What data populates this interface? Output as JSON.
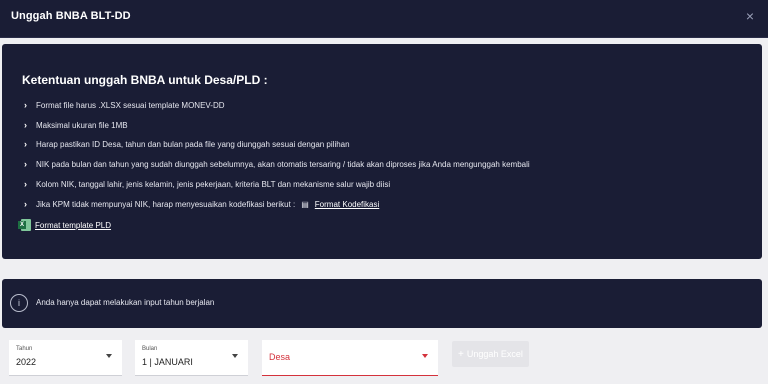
{
  "header": {
    "title": "Unggah BNBA BLT-DD",
    "close": "×"
  },
  "rules_card": {
    "title": "Ketentuan unggah BNBA untuk Desa/PLD :",
    "items": [
      "Format file harus .XLSX sesuai template MONEV-DD",
      "Maksimal ukuran file 1MB",
      "Harap pastikan ID Desa, tahun dan bulan pada file yang diunggah sesuai dengan pilihan",
      "NIK pada bulan dan tahun yang sudah diunggah sebelumnya, akan otomatis tersaring / tidak akan diproses jika Anda mengunggah kembali",
      "Kolom NIK, tanggal lahir, jenis kelamin, jenis pekerjaan, kriteria BLT dan mekanisme salur wajib diisi",
      "Jika KPM tidak mempunyai NIK, harap menyesuaikan kodefikasi berikut :"
    ],
    "kodefikasi_link": "Format Kodefikasi",
    "template_link": "Format template PLD",
    "excel_icon_letter": "X"
  },
  "notice": {
    "text": "Anda hanya dapat melakukan input tahun berjalan",
    "icon": "info-icon"
  },
  "form": {
    "tahun": {
      "label": "Tahun",
      "value": "2022"
    },
    "bulan": {
      "label": "Bulan",
      "value": "1 | JANUARI"
    },
    "desa": {
      "placeholder": "Desa"
    },
    "upload_button": "Unggah Excel"
  },
  "colors": {
    "dark_bg": "#1a1d35",
    "error": "#d4323c",
    "excel_green": "#1d6f42"
  }
}
